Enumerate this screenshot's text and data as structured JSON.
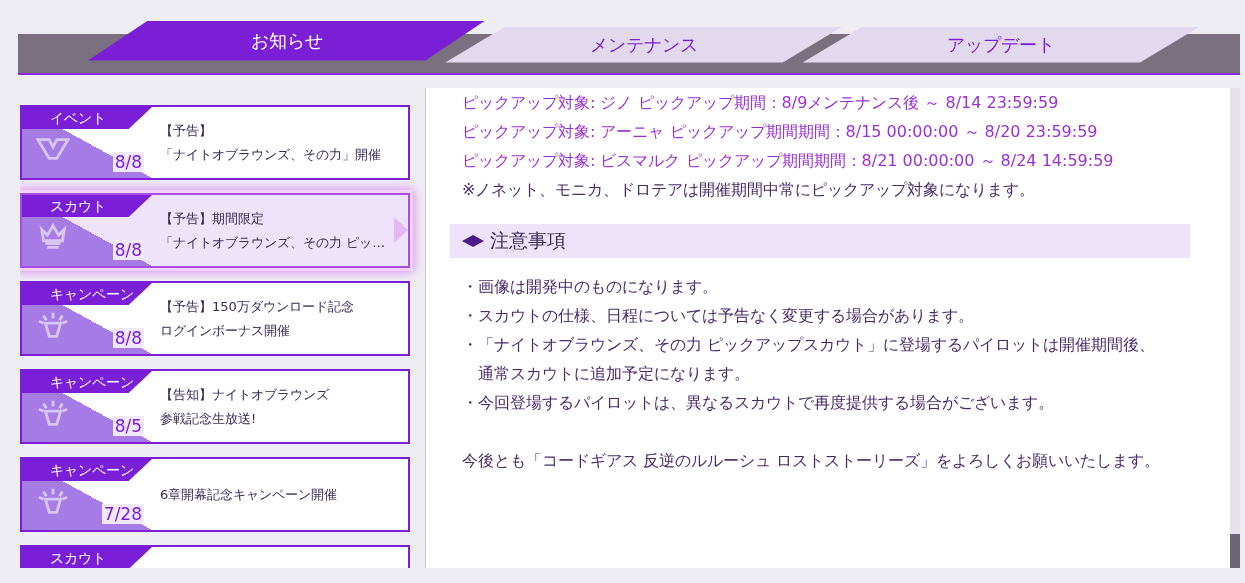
{
  "tabs": [
    {
      "label": "お知らせ",
      "selected": true
    },
    {
      "label": "メンテナンス",
      "selected": false
    },
    {
      "label": "アップデート",
      "selected": false
    }
  ],
  "notices": [
    {
      "kind": "event",
      "category": "イベント",
      "date": "8/8",
      "title_lines": [
        "【予告】",
        "「ナイトオブラウンズ、その力」開催"
      ],
      "selected": false
    },
    {
      "kind": "scout",
      "category": "スカウト",
      "date": "8/8",
      "title_lines": [
        "【予告】期間限定",
        "「ナイトオブラウンズ、その力 ピッ…"
      ],
      "selected": true
    },
    {
      "kind": "campaign",
      "category": "キャンペーン",
      "date": "8/8",
      "title_lines": [
        "【予告】150万ダウンロード記念",
        "ログインボーナス開催"
      ],
      "selected": false
    },
    {
      "kind": "campaign",
      "category": "キャンペーン",
      "date": "8/5",
      "title_lines": [
        "【告知】ナイトオブラウンズ",
        "参戦記念生放送!"
      ],
      "selected": false
    },
    {
      "kind": "campaign",
      "category": "キャンペーン",
      "date": "7/28",
      "title_lines": [
        "6章開幕記念キャンペーン開催"
      ],
      "selected": false
    },
    {
      "kind": "scout",
      "category": "スカウト",
      "selected": false
    }
  ],
  "article": {
    "pickup_lines": [
      "ピックアップ対象: ジノ ピックアップ期間：8/9メンテナンス後 ～ 8/14 23:59:59",
      "ピックアップ対象: アーニャ ピックアップ期間期間：8/15 00:00:00 ～ 8/20 23:59:59",
      "ピックアップ対象: ビスマルク ピックアップ期間期間：8/21 00:00:00 ～ 8/24 14:59:59"
    ],
    "note": "※ノネット、モニカ、ドロテアは開催期間中常にピックアップ対象になります。",
    "section_heading": "注意事項",
    "bullets": [
      {
        "lines": [
          "・画像は開発中のものになります。"
        ]
      },
      {
        "lines": [
          "・スカウトの仕様、日程については予告なく変更する場合があります。"
        ]
      },
      {
        "lines": [
          "・「ナイトオブラウンズ、その力 ピックアップスカウト」に登場するパイロットは開催期間後、",
          "通常スカウトに追加予定になります。"
        ]
      },
      {
        "lines": [
          "・今回登場するパイロットは、異なるスカウトで再度提供する場合がございます。"
        ]
      }
    ],
    "closing": "今後とも「コードギアス 反逆のルルーシュ ロストストーリーズ」をよろしくお願いいたします。"
  }
}
